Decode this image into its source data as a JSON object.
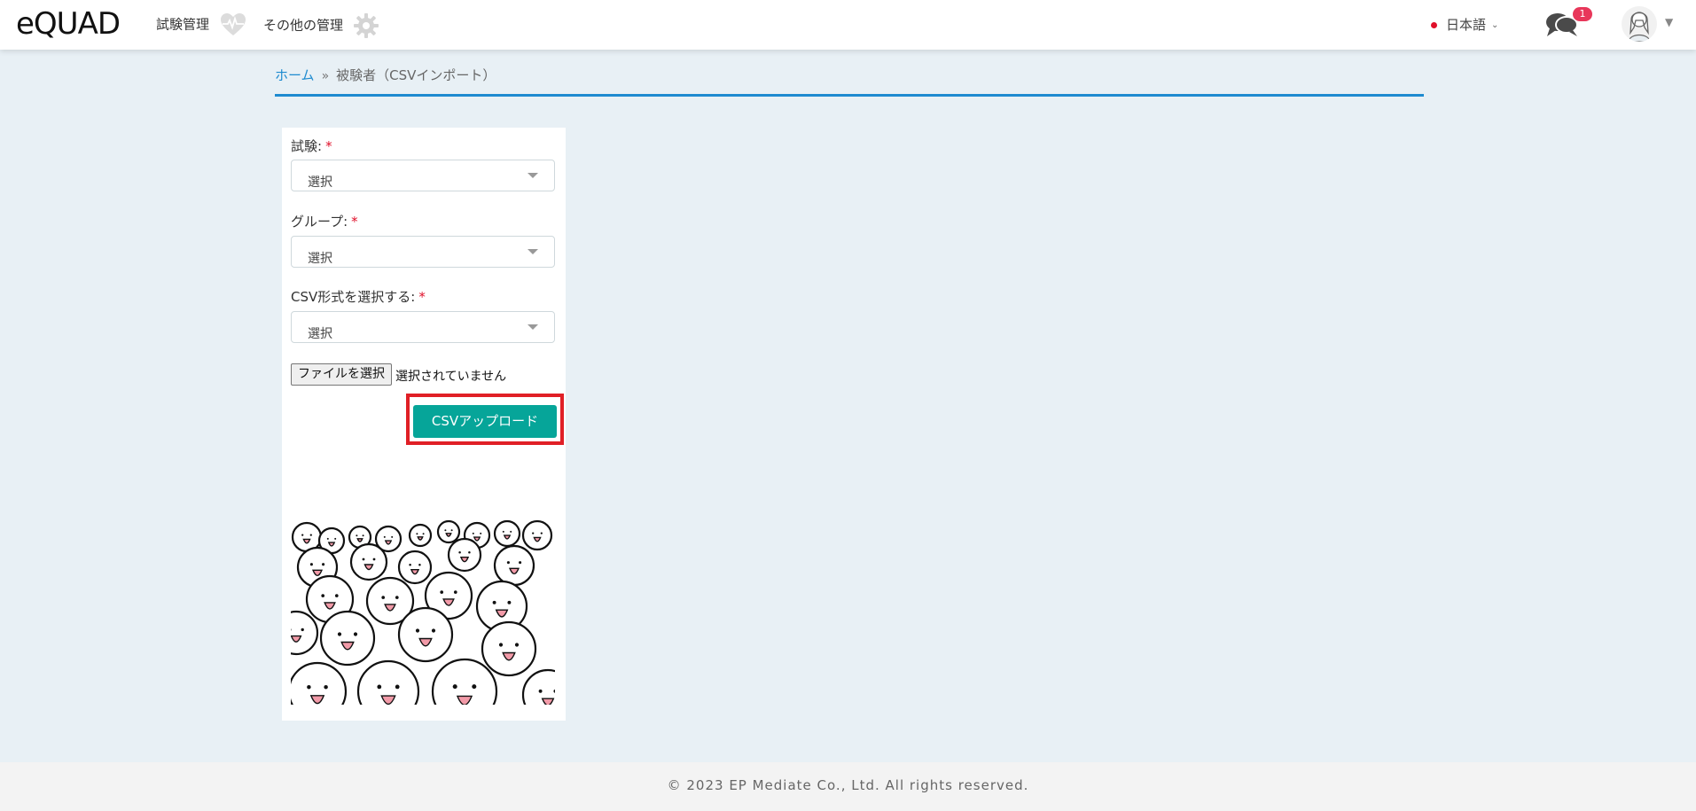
{
  "header": {
    "logo_text": "eQUAD",
    "nav": [
      {
        "label": "試験管理",
        "icon": "heart-pulse-icon"
      },
      {
        "label": "その他の管理",
        "icon": "gear-icon"
      }
    ],
    "language": "日本語",
    "notification_count": "1",
    "icons": {
      "chat": "chat-bubbles-icon",
      "avatar": "user-avatar"
    }
  },
  "breadcrumb": {
    "home": "ホーム",
    "separator": "»",
    "current": "被験者（CSVインポート）"
  },
  "form": {
    "fields": [
      {
        "label": "試験:",
        "required_mark": "*",
        "value": "選択"
      },
      {
        "label": "グループ:",
        "required_mark": "*",
        "value": "選択"
      },
      {
        "label": "CSV形式を選択する:",
        "required_mark": "*",
        "value": "選択"
      }
    ],
    "file_button": "ファイルを選択",
    "file_status": "選択されていません",
    "upload_button": "CSVアップロード"
  },
  "footer": {
    "copyright": "© 2023 EP Mediate Co., Ltd. All rights reserved."
  },
  "colors": {
    "accent": "#1e8bd0",
    "primary_button": "#06a599",
    "highlight": "#e01f26",
    "required": "#e0102a"
  }
}
